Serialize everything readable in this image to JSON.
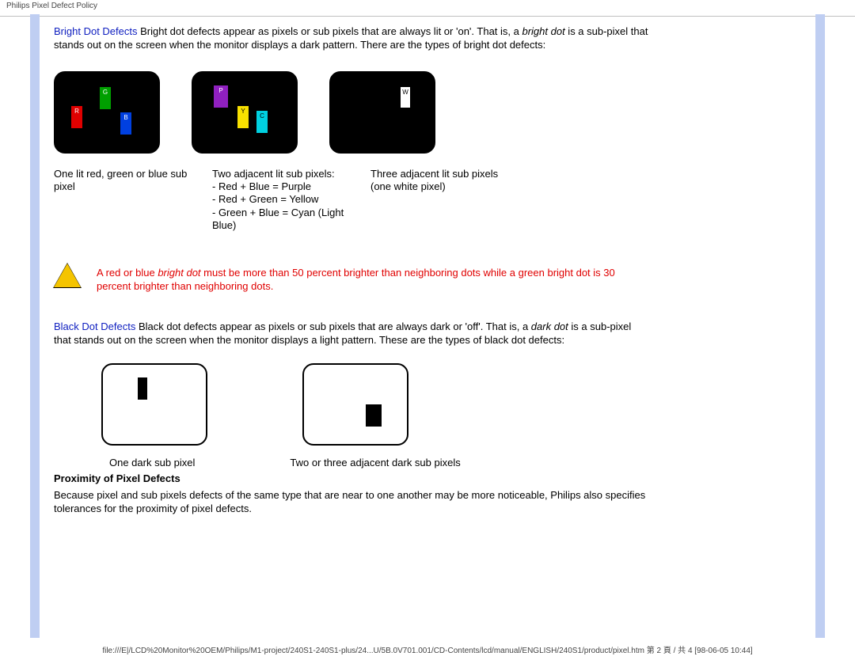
{
  "header": {
    "title": "Philips Pixel Defect Policy"
  },
  "bright": {
    "lead": "Bright Dot Defects",
    "body": " Bright dot defects appear as pixels or sub pixels that are always lit or 'on'. That is, a ",
    "emph": "bright dot",
    "body2": " is a sub-pixel that stands out on the screen when the monitor displays a dark pattern. There are the types of bright dot defects:",
    "pixlabels": {
      "R": "R",
      "G": "G",
      "B": "B",
      "P": "P",
      "Y": "Y",
      "C": "C",
      "W": "W"
    },
    "cap1": "One lit red, green or blue sub pixel",
    "cap2_title": "Two adjacent lit sub pixels:",
    "cap2_l1": "- Red + Blue = Purple",
    "cap2_l2": "- Red + Green = Yellow",
    "cap2_l3": "- Green + Blue = Cyan (Light Blue)",
    "cap3": "Three adjacent lit sub pixels (one white pixel)"
  },
  "warning": {
    "line1_a": "A red or blue ",
    "line1_em": "bright dot",
    "line1_b": " must be more than 50 percent brighter than neighboring dots while a green bright dot is 30 percent brighter than neighboring dots."
  },
  "black": {
    "lead": "Black Dot Defects",
    "body": " Black dot defects appear as pixels or sub pixels that are always dark or 'off'. That is, a ",
    "emph": "dark dot",
    "body2": " is a sub-pixel that stands out on the screen when the monitor displays a light pattern. These are the types of black dot defects:",
    "cap1": "One dark sub pixel",
    "cap2": "Two or three adjacent dark sub pixels"
  },
  "proximity": {
    "title": "Proximity of Pixel Defects",
    "body": "Because pixel and sub pixels defects of the same type that are near to one another may be more noticeable, Philips also specifies tolerances for the proximity of pixel defects."
  },
  "footer": {
    "path": "file:///E|/LCD%20Monitor%20OEM/Philips/M1-project/240S1-240S1-plus/24...U/5B.0V701.001/CD-Contents/lcd/manual/ENGLISH/240S1/product/pixel.htm 第 2 頁 / 共 4  [98-06-05 10:44]"
  }
}
